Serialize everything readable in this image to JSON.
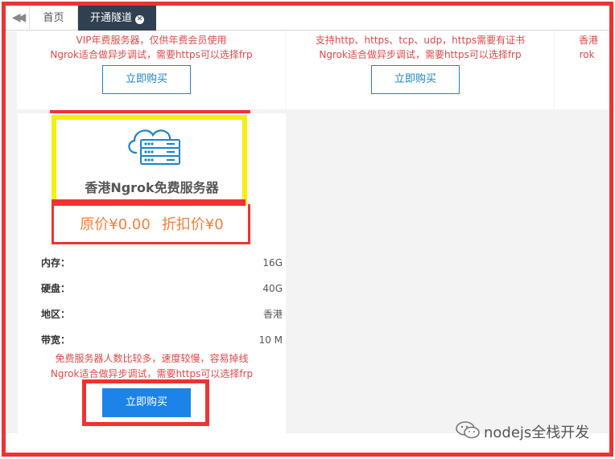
{
  "tabs": {
    "home": "首页",
    "active": "开通隧道"
  },
  "top_cards": [
    {
      "desc": [
        "VIP年费服务器，仅供年费会员使用",
        "Ngrok适合做异步调试，需要https可以选择frp"
      ],
      "button": "立即购买"
    },
    {
      "desc": [
        "支持http、https、tcp、udp，https需要有证书",
        "Ngrok适合做异步调试，需要https可以选择frp"
      ],
      "button": "立即购买"
    },
    {
      "desc": [
        "香港",
        "Ngrok"
      ]
    }
  ],
  "main_card": {
    "icon": "cloud-server-icon",
    "title": "香港Ngrok免费服务器",
    "original_price": "原价¥0.00",
    "discount_price": "折扣价¥0",
    "specs": [
      {
        "label": "内存：",
        "value": "16G"
      },
      {
        "label": "硬盘：",
        "value": "40G"
      },
      {
        "label": "地区：",
        "value": "香港"
      },
      {
        "label": "带宽：",
        "value": "10 M"
      }
    ],
    "desc": [
      "免费服务器人数比较多，速度较慢，容易掉线",
      "Ngrok适合做异步调试，需要https可以选择frp"
    ],
    "button": "立即购买"
  },
  "watermark": "nodejs全栈开发",
  "colors": {
    "accent": "#1c84c6",
    "primary_button": "#1c84e8",
    "warning_text": "#e04848",
    "price": "#f0803c",
    "tab_active": "#2f4050",
    "annotation_red": "#ee3333",
    "annotation_yellow": "#f5f00a"
  }
}
